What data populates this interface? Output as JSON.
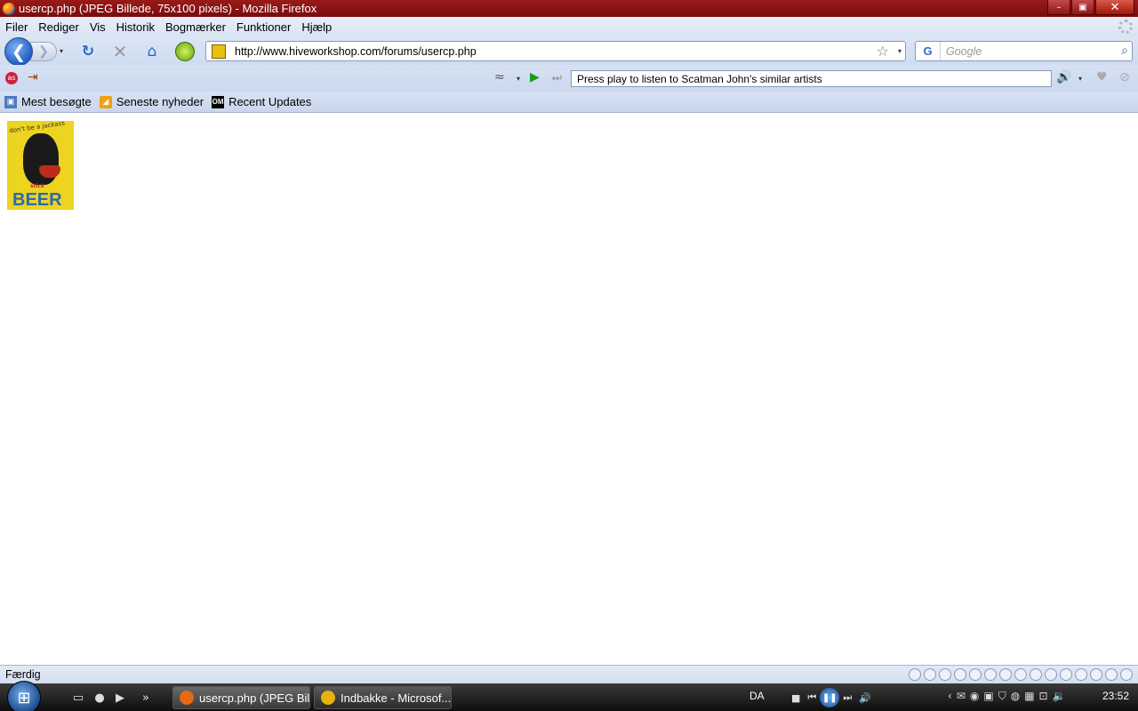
{
  "window": {
    "title": "usercp.php (JPEG Billede, 75x100 pixels) - Mozilla Firefox",
    "minimize_glyph": "–",
    "maximize_glyph": "▣",
    "close_glyph": "✕"
  },
  "menubar": {
    "items": [
      "Filer",
      "Rediger",
      "Vis",
      "Historik",
      "Bogmærker",
      "Funktioner",
      "Hjælp"
    ]
  },
  "navbar": {
    "url": "http://www.hiveworkshop.com/forums/usercp.php",
    "search_placeholder": "Google",
    "search_engine_glyph": "G",
    "back_glyph": "❮",
    "forward_glyph": "❯",
    "reload_glyph": "↻",
    "stop_glyph": "✕",
    "home_glyph": "⌂",
    "star_glyph": "☆",
    "search_glyph": "⌕",
    "dropdown_glyph": "▾"
  },
  "player_toolbar": {
    "status_text": "Press play to listen to Scatman John's similar artists",
    "lastfm_glyph": "as",
    "exit_glyph": "⇥",
    "wifi_glyph": "≈",
    "play_glyph": "▶",
    "skip_glyph": "⏭",
    "volume_glyph": "🔊",
    "love_glyph": "♥",
    "ban_glyph": "⊘",
    "dropdown_glyph": "▾"
  },
  "bookmarks": {
    "items": [
      {
        "label": "Mest besøgte",
        "icon": "most-visited-icon",
        "glyph": "▣"
      },
      {
        "label": "Seneste nyheder",
        "icon": "rss-feed-icon",
        "glyph": "◢"
      },
      {
        "label": "Recent Updates",
        "icon": "om-logo-icon",
        "glyph": "OM"
      }
    ]
  },
  "content": {
    "image": {
      "top_text": "don't be a jackass",
      "stick_text": "stick",
      "big_text": "BEER"
    }
  },
  "statusbar": {
    "text": "Færdig"
  },
  "taskbar": {
    "start_glyph": "⊞",
    "quicklaunch_more": "»",
    "tasks": [
      {
        "label": "usercp.php (JPEG Bil...",
        "icon": "firefox-icon",
        "color": "#e86a10"
      },
      {
        "label": "Indbakke - Microsof...",
        "icon": "outlook-icon",
        "color": "#e8b010"
      }
    ],
    "language": "DA",
    "clock": "23:52",
    "pause_glyph": "❚❚"
  },
  "colors": {
    "titlebar": "#8a1212",
    "toolbar": "#d6e2f3",
    "taskbar": "#1e1e1e",
    "image_bg": "#ecd420",
    "beer_text": "#2a6ab0"
  }
}
